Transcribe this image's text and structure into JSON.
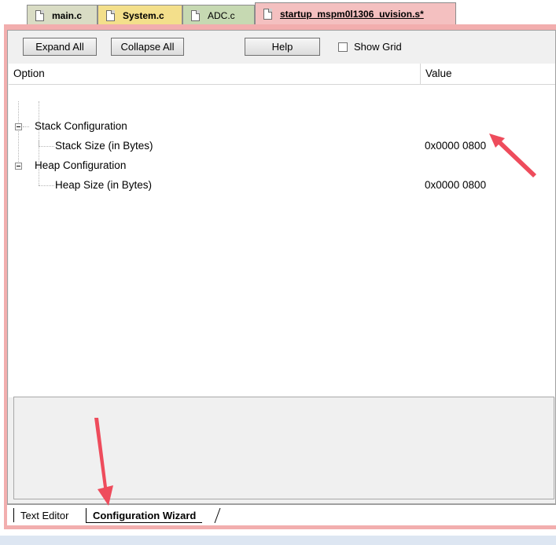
{
  "file_tabs": [
    {
      "label": "main.c"
    },
    {
      "label": "System.c"
    },
    {
      "label": "ADC.c"
    },
    {
      "label": "startup_mspm0l1306_uvision.s*",
      "active": true
    }
  ],
  "toolbar": {
    "expand_all": "Expand All",
    "collapse_all": "Collapse All",
    "help": "Help",
    "show_grid": "Show Grid",
    "show_grid_checked": false
  },
  "grid": {
    "columns": [
      "Option",
      "Value"
    ],
    "rows": [
      {
        "label": "Stack Configuration",
        "value": "",
        "level": 0
      },
      {
        "label": "Stack Size (in Bytes)",
        "value": "0x0000 0800",
        "level": 1
      },
      {
        "label": "Heap Configuration",
        "value": "",
        "level": 0
      },
      {
        "label": "Heap Size (in Bytes)",
        "value": "0x0000 0800",
        "level": 1
      }
    ]
  },
  "bottom_tabs": {
    "text_editor": "Text Editor",
    "configuration_wizard": "Configuration Wizard"
  },
  "colors": {
    "tab_main": "#d9dcc4",
    "tab_system": "#f3df8b",
    "tab_adc": "#c6d9b2",
    "tab_startup": "#f4c0c0",
    "annotation_arrow": "#ee4c5c"
  }
}
